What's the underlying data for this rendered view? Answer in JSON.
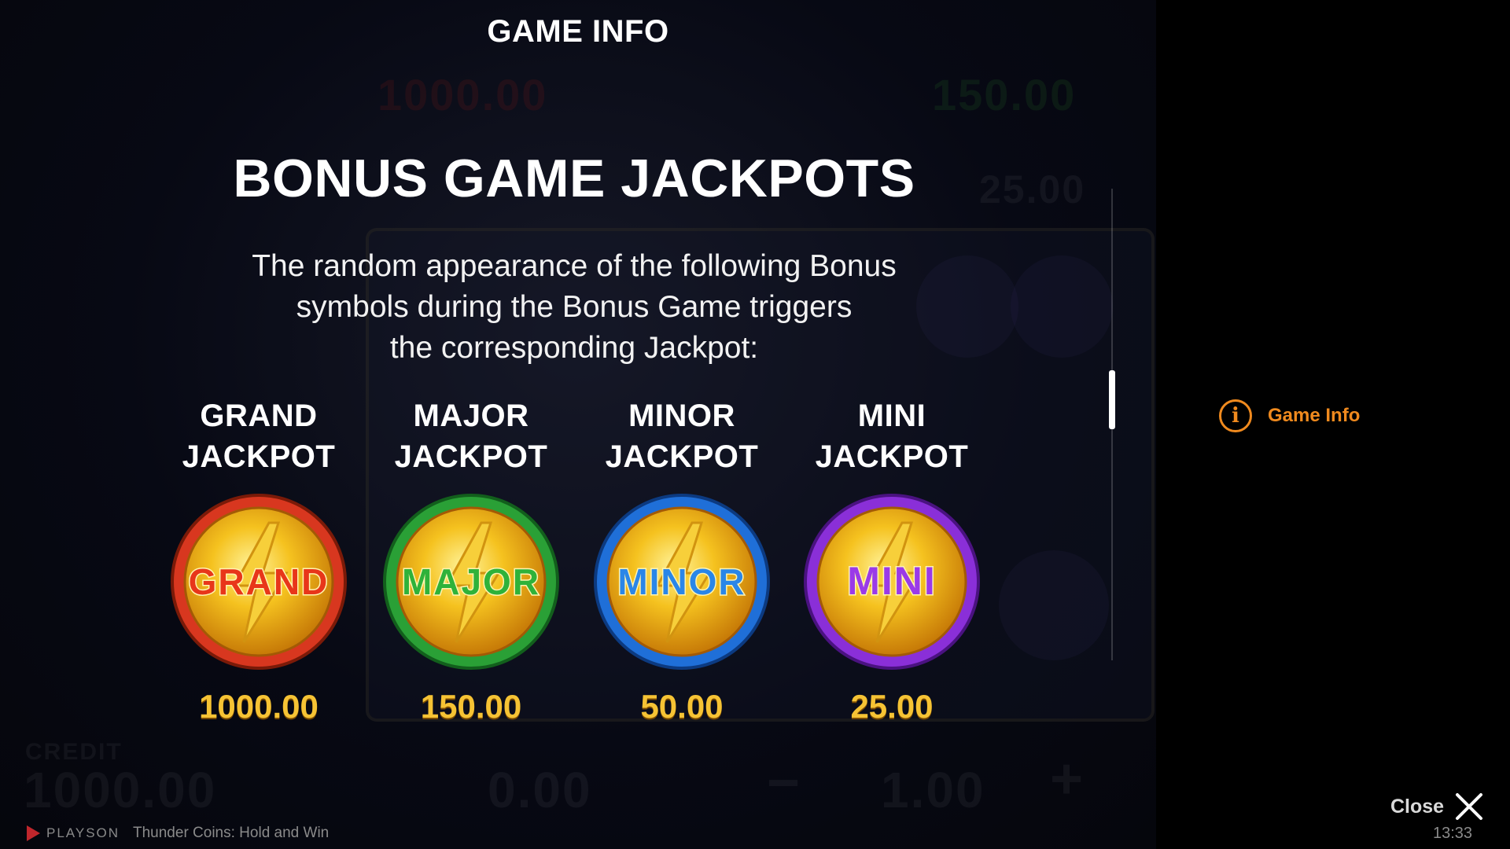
{
  "header": {
    "title": "GAME INFO"
  },
  "background": {
    "credit_label": "CREDIT",
    "credit_value": "1000.00",
    "win_value": "0.00",
    "bet_value": "1.00",
    "minus_symbol": "−",
    "plus_symbol": "+",
    "brand": "PLAYSON",
    "game_name": "Thunder Coins: Hold and Win"
  },
  "section": {
    "title": "BONUS GAME JACKPOTS",
    "description_lines": [
      "The random appearance of the following Bonus",
      "symbols during the Bonus Game triggers",
      "the corresponding Jackpot:"
    ]
  },
  "jackpots": [
    {
      "label_line1": "GRAND",
      "label_line2": "JACKPOT",
      "coin_text": "GRAND",
      "value": "1000.00",
      "ring_color": "#d8371f",
      "text_color": "#e8361a"
    },
    {
      "label_line1": "MAJOR",
      "label_line2": "JACKPOT",
      "coin_text": "MAJOR",
      "value": "150.00",
      "ring_color": "#2aa036",
      "text_color": "#2fb23a"
    },
    {
      "label_line1": "MINOR",
      "label_line2": "JACKPOT",
      "coin_text": "MINOR",
      "value": "50.00",
      "ring_color": "#1f6fd8",
      "text_color": "#2a86e8"
    },
    {
      "label_line1": "MINI",
      "label_line2": "JACKPOT",
      "coin_text": "MINI",
      "value": "25.00",
      "ring_color": "#8a2fd8",
      "text_color": "#9a3ae8"
    }
  ],
  "sidebar": {
    "info_icon": "info-icon",
    "info_label": "Game Info",
    "accent": "#f08a1e"
  },
  "close": {
    "label": "Close",
    "icon": "close-icon"
  },
  "clock": "13:33"
}
